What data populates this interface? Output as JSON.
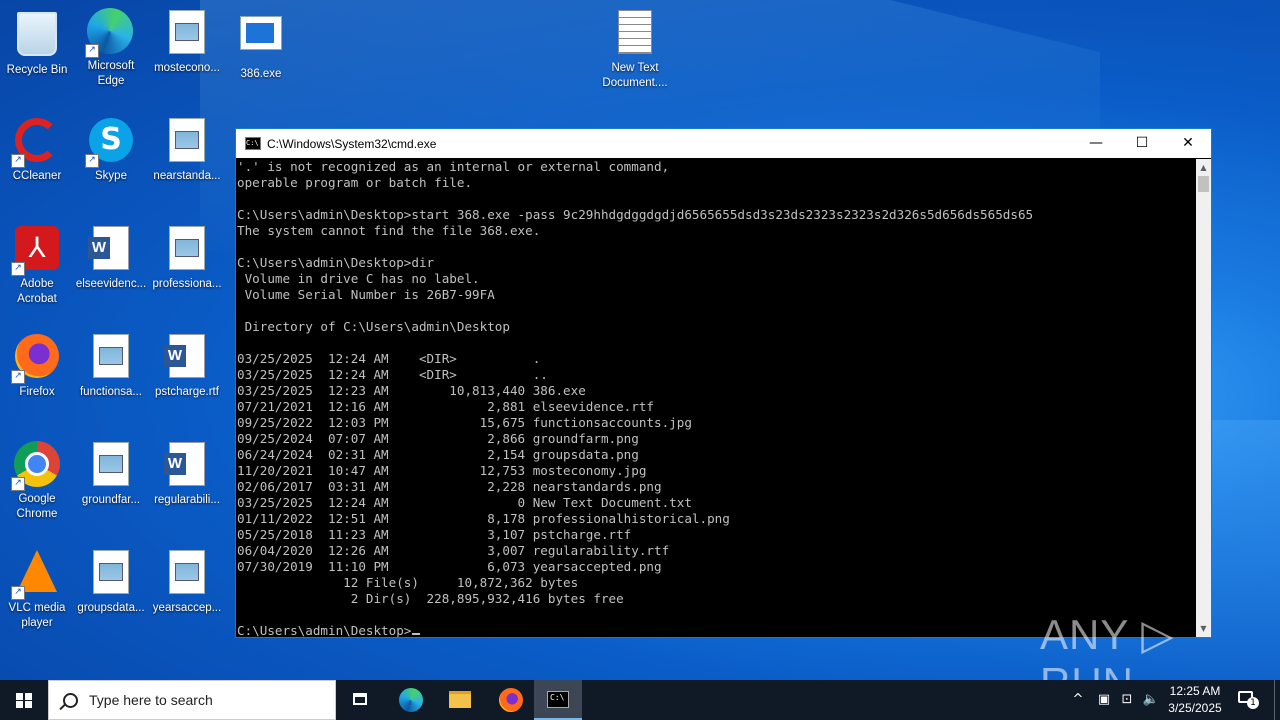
{
  "desktop": {
    "icons": [
      {
        "label": "Recycle Bin",
        "icon": "recycle-bin-icon"
      },
      {
        "label": "Microsoft\nEdge",
        "icon": "edge-icon"
      },
      {
        "label": "mosteconо...",
        "icon": "image-file-icon"
      },
      {
        "label": "386.exe",
        "icon": "exe-icon"
      },
      {
        "label": "New Text\nDocument....",
        "icon": "text-file-icon"
      },
      {
        "label": "CCleaner",
        "icon": "ccleaner-icon"
      },
      {
        "label": "Skype",
        "icon": "skype-icon"
      },
      {
        "label": "nearstanda...",
        "icon": "image-file-icon"
      },
      {
        "label": "Adobe\nAcrobat",
        "icon": "acrobat-icon"
      },
      {
        "label": "elseevidenc...",
        "icon": "word-doc-icon"
      },
      {
        "label": "professiona...",
        "icon": "image-file-icon"
      },
      {
        "label": "Firefox",
        "icon": "firefox-icon"
      },
      {
        "label": "functionsa...",
        "icon": "image-file-icon"
      },
      {
        "label": "pstcharge.rtf",
        "icon": "word-doc-icon"
      },
      {
        "label": "Google\nChrome",
        "icon": "chrome-icon"
      },
      {
        "label": "groundfar...",
        "icon": "image-file-icon"
      },
      {
        "label": "regularabili...",
        "icon": "word-doc-icon"
      },
      {
        "label": "VLC media\nplayer",
        "icon": "vlc-icon"
      },
      {
        "label": "groupsdata...",
        "icon": "image-file-icon"
      },
      {
        "label": "yearsaccep...",
        "icon": "image-file-icon"
      }
    ]
  },
  "cmd_window": {
    "title": "C:\\Windows\\System32\\cmd.exe",
    "minimize": "—",
    "maximize": "☐",
    "close": "✕",
    "lines": [
      "'.' is not recognized as an internal or external command,",
      "operable program or batch file.",
      "",
      "C:\\Users\\admin\\Desktop>start 368.exe -pass 9c29hhdgdggdgdjd6565655dsd3s23ds2323s2323s2d326s5d656ds565ds65",
      "The system cannot find the file 368.exe.",
      "",
      "C:\\Users\\admin\\Desktop>dir",
      " Volume in drive C has no label.",
      " Volume Serial Number is 26B7-99FA",
      "",
      " Directory of C:\\Users\\admin\\Desktop",
      "",
      "03/25/2025  12:24 AM    <DIR>          .",
      "03/25/2025  12:24 AM    <DIR>          ..",
      "03/25/2025  12:23 AM        10,813,440 386.exe",
      "07/21/2021  12:16 AM             2,881 elseevidence.rtf",
      "09/25/2022  12:03 PM            15,675 functionsaccounts.jpg",
      "09/25/2024  07:07 AM             2,866 groundfarm.png",
      "06/24/2024  02:31 AM             2,154 groupsdata.png",
      "11/20/2021  10:47 AM            12,753 mosteconomy.jpg",
      "02/06/2017  03:31 AM             2,228 nearstandards.png",
      "03/25/2025  12:24 AM                 0 New Text Document.txt",
      "01/11/2022  12:51 AM             8,178 professionalhistorical.png",
      "05/25/2018  11:23 AM             3,107 pstcharge.rtf",
      "06/04/2020  12:26 AM             3,007 regularability.rtf",
      "07/30/2019  11:10 PM             6,073 yearsaccepted.png",
      "              12 File(s)     10,872,362 bytes",
      "               2 Dir(s)  228,895,932,416 bytes free",
      ""
    ],
    "prompt": "C:\\Users\\admin\\Desktop>"
  },
  "watermark": "ANY ▷ RUN",
  "taskbar": {
    "search_placeholder": "Type here to search",
    "tray": {
      "chevron": "^",
      "time": "12:25 AM",
      "date": "3/25/2025",
      "notification_count": "1"
    }
  }
}
